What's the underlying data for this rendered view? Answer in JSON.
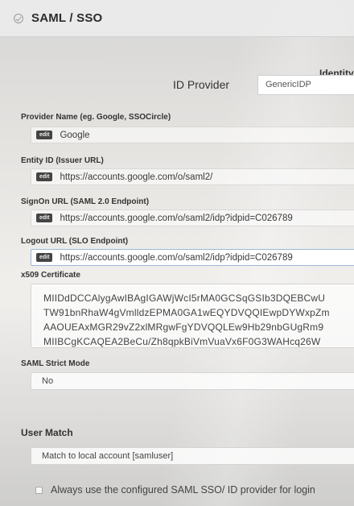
{
  "header": {
    "title": "SAML / SSO"
  },
  "identity_heading": "Identity",
  "id_provider": {
    "label": "ID Provider",
    "value": "GenericIDP"
  },
  "edit_badge": "edit",
  "fields": [
    {
      "label": "Provider Name (eg. Google, SSOCircle)",
      "value": "Google"
    },
    {
      "label": "Entity ID (Issuer URL)",
      "value": "https://accounts.google.com/o/saml2/"
    },
    {
      "label": "SignOn URL (SAML 2.0 Endpoint)",
      "value": "https://accounts.google.com/o/saml2/idp?idpid=C026789"
    },
    {
      "label": "Logout URL (SLO Endpoint)",
      "value": "https://accounts.google.com/o/saml2/idp?idpid=C026789"
    }
  ],
  "certificate": {
    "label": "x509 Certificate",
    "lines": [
      "MIIDdDCCAlygAwIBAgIGAWjWcI5rMA0GCSqGSIb3DQEBCwU",
      "TW91bnRhaW4gVmlldzEPMA0GA1wEQYDVQQIEwpDYWxpZm",
      "AAOUEAxMGR29vZ2xlMRgwFgYDVQQLEw9Hb29nbGUgRm9",
      "MIIBCgKCAQEA2BeCu/Zh8qpkBiVmVuaVx6F0G3WAHcq26W"
    ]
  },
  "strict_mode": {
    "label": "SAML Strict Mode",
    "value": "No"
  },
  "user_match": {
    "label": "User Match",
    "value": "Match to local account [samluser]"
  },
  "always_use": {
    "label": "Always use the configured SAML SSO/ ID provider for login",
    "checked": false
  }
}
